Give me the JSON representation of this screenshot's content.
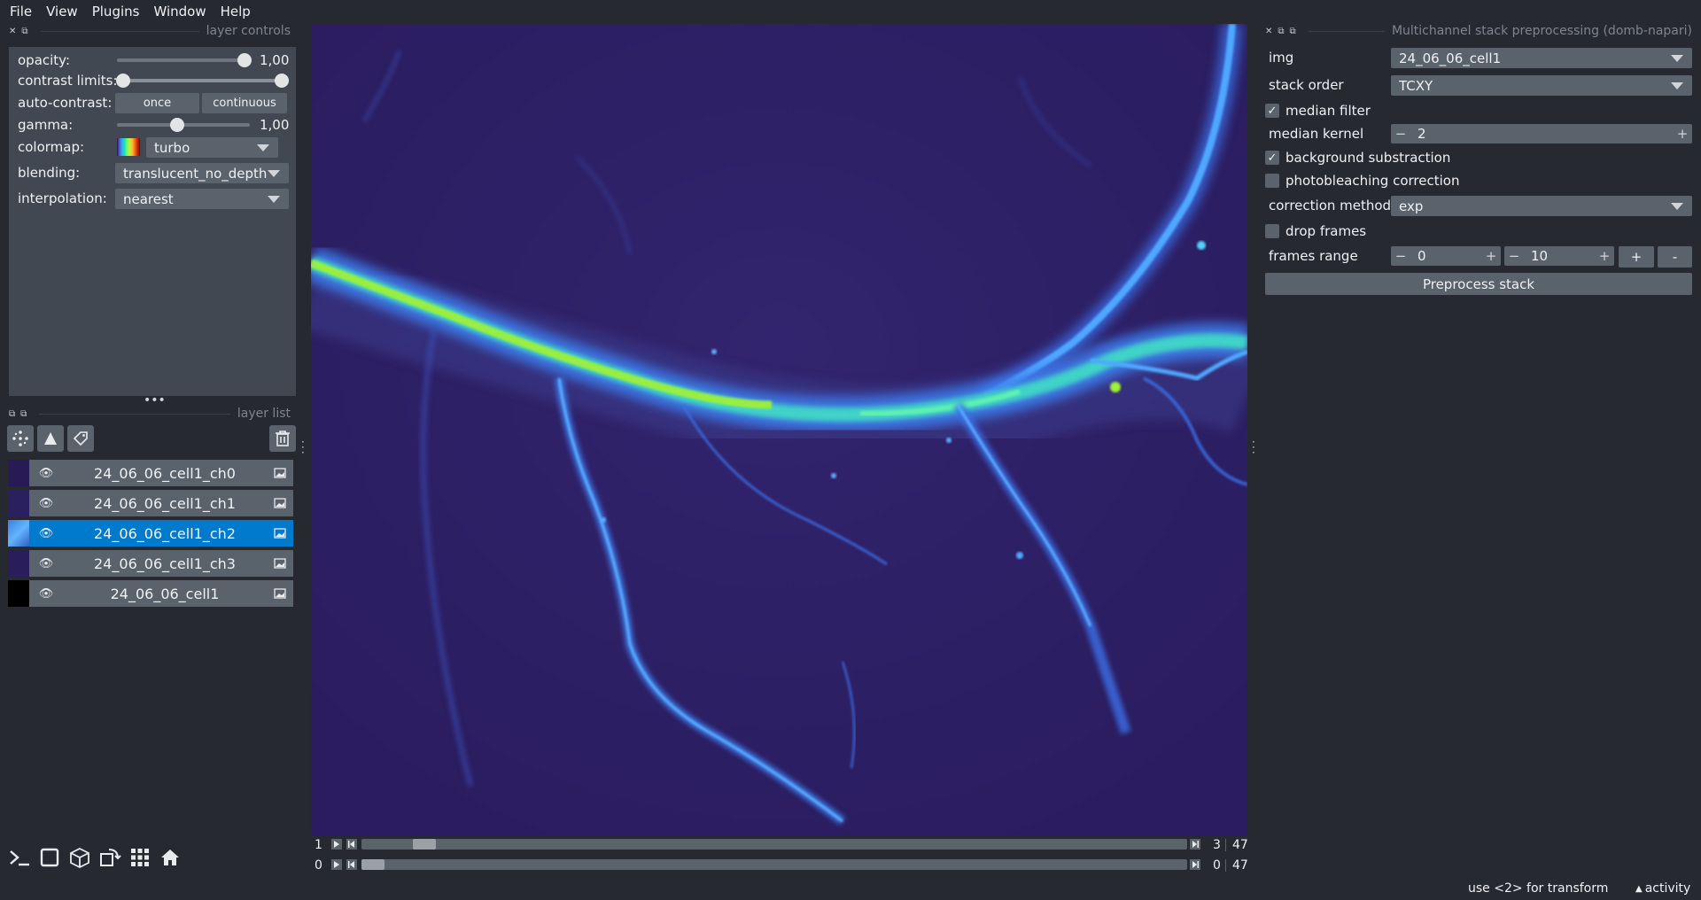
{
  "menu": [
    "File",
    "View",
    "Plugins",
    "Window",
    "Help"
  ],
  "layer_controls": {
    "title": "layer controls",
    "opacity_label": "opacity:",
    "opacity_value": "1,00",
    "opacity_level": 1.0,
    "contrast_label": "contrast limits:",
    "contrast_range": [
      0.0,
      1.0
    ],
    "autocontrast_label": "auto-contrast:",
    "once_label": "once",
    "continuous_label": "continuous",
    "gamma_label": "gamma:",
    "gamma_value": "1,00",
    "colormap_label": "colormap:",
    "colormap_value": "turbo",
    "blending_label": "blending:",
    "blending_value": "translucent_no_depth",
    "interpolation_label": "interpolation:",
    "interpolation_value": "nearest"
  },
  "layer_list": {
    "title": "layer list",
    "layers": [
      {
        "name": "24_06_06_cell1_ch0",
        "selected": false
      },
      {
        "name": "24_06_06_cell1_ch1",
        "selected": false
      },
      {
        "name": "24_06_06_cell1_ch2",
        "selected": true
      },
      {
        "name": "24_06_06_cell1_ch3",
        "selected": false
      },
      {
        "name": "24_06_06_cell1",
        "selected": false
      }
    ]
  },
  "dims": [
    {
      "label": "1",
      "current": "3",
      "total": "47",
      "position": 3
    },
    {
      "label": "0",
      "current": "0",
      "total": "47",
      "position": 0
    }
  ],
  "plugin": {
    "title": "Multichannel stack preprocessing (domb-napari)",
    "img_label": "img",
    "img_value": "24_06_06_cell1",
    "stack_order_label": "stack order",
    "stack_order_value": "TCXY",
    "median_filter_label": "median filter",
    "median_filter_checked": true,
    "median_kernel_label": "median kernel",
    "median_kernel_value": "2",
    "bg_sub_label": "background substraction",
    "bg_sub_checked": true,
    "photobleach_label": "photobleaching correction",
    "photobleach_checked": false,
    "correction_method_label": "correction method",
    "correction_method_value": "exp",
    "drop_frames_label": "drop frames",
    "drop_frames_checked": false,
    "frames_range_label": "frames range",
    "frames_start": "0",
    "frames_end": "10",
    "plus_label": "+",
    "minus_label": "-",
    "preprocess_label": "Preprocess stack"
  },
  "status": {
    "hint": "use <2> for transform",
    "activity": "activity"
  },
  "colors": {
    "background": "#262930",
    "panel": "#414851",
    "control": "#5a626c",
    "selected": "#007acc",
    "canvas_bg": "#2c1f63"
  }
}
